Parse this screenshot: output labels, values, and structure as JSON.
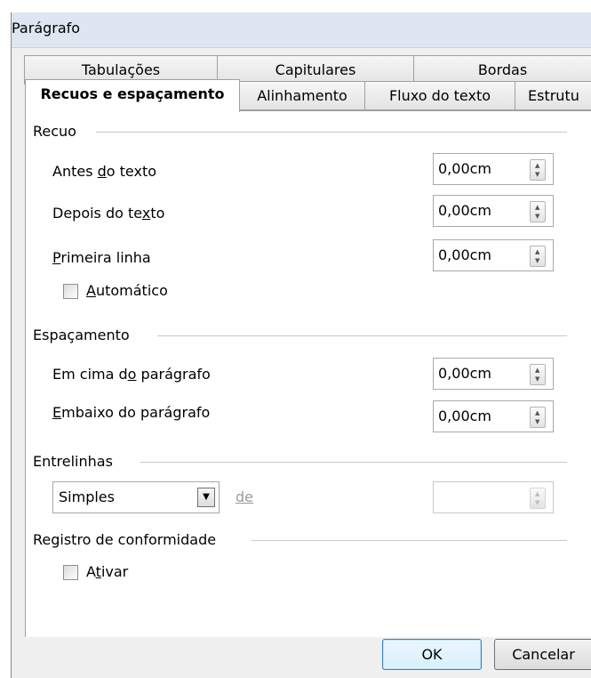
{
  "window": {
    "title": "Parágrafo"
  },
  "tabs_back": [
    {
      "label": "Tabulações"
    },
    {
      "label": "Capitulares"
    },
    {
      "label": "Bordas"
    }
  ],
  "tabs_front": [
    {
      "label": "Recuos e espaçamento",
      "active": true
    },
    {
      "label": "Alinhamento"
    },
    {
      "label": "Fluxo do texto"
    },
    {
      "label": "Estrutu"
    }
  ],
  "indent": {
    "title": "Recuo",
    "before_text": {
      "pre": "Antes ",
      "acc": "d",
      "post": "o texto",
      "value": "0,00cm"
    },
    "after_text": {
      "pre": "Depois do te",
      "acc": "x",
      "post": "to",
      "value": "0,00cm"
    },
    "first_line": {
      "pre": "",
      "acc": "P",
      "post": "rimeira linha",
      "value": "0,00cm"
    },
    "automatic": {
      "pre": "",
      "acc": "A",
      "post": "utomático",
      "checked": false
    }
  },
  "spacing": {
    "title": "Espaçamento",
    "above": {
      "pre": "Em cima d",
      "acc": "o",
      "post": " parágrafo",
      "value": "0,00cm"
    },
    "below": {
      "pre": "",
      "acc": "E",
      "post": "mbaixo do parágrafo",
      "value": "0,00cm"
    }
  },
  "line_spacing": {
    "title": "Entrelinhas",
    "selected": "Simples",
    "of_label": "de",
    "value": ""
  },
  "register": {
    "title": "Registro de conformidade",
    "activate": {
      "pre": "A",
      "acc": "t",
      "post": "ivar",
      "checked": false
    }
  },
  "buttons": {
    "ok": "OK",
    "cancel": "Cancelar"
  }
}
